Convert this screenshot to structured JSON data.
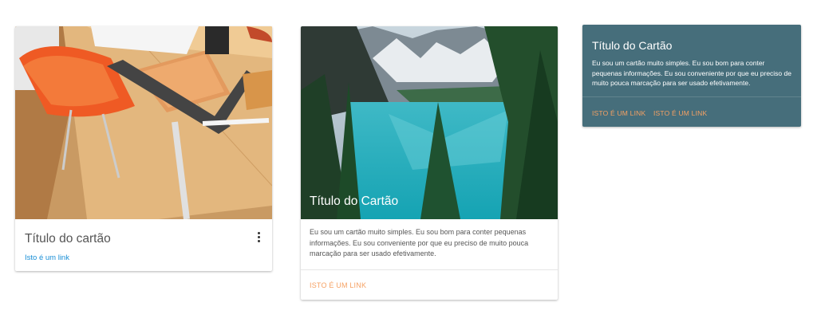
{
  "cards": [
    {
      "title": "Título do cartão",
      "link": "Isto é um link",
      "link_color": "#1a8fd6",
      "menu_icon": "more-vertical-icon"
    },
    {
      "image_title": "Título do Cartão",
      "text": "Eu sou um cartão muito simples. Eu sou bom para conter pequenas informações. Eu sou conveniente por que eu preciso de muito pouca marcação para ser usado efetivamente.",
      "link": "ISTO É UM LINK",
      "link_color": "#f6a163"
    },
    {
      "title": "Título do Cartão",
      "text": "Eu sou um cartão muito simples. Eu sou bom para conter pequenas informações. Eu sou conveniente por que eu preciso de muito pouca marcação para ser usado efetivamente.",
      "links": [
        "ISTO É UM LINK",
        "ISTO É UM LINK"
      ],
      "background": "#466e7b",
      "link_color": "#f6a163"
    }
  ]
}
